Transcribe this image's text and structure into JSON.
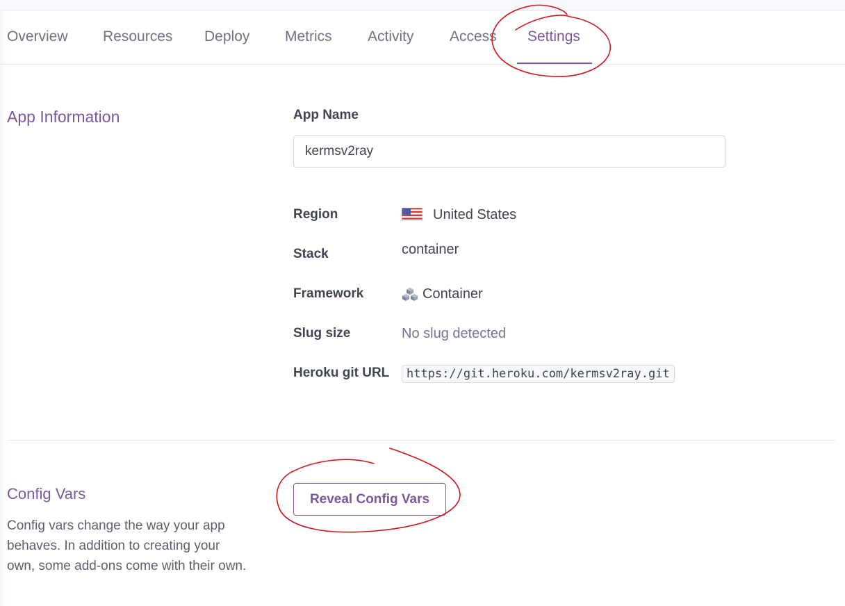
{
  "tabs": [
    {
      "label": "Overview"
    },
    {
      "label": "Resources"
    },
    {
      "label": "Deploy"
    },
    {
      "label": "Metrics"
    },
    {
      "label": "Activity"
    },
    {
      "label": "Access"
    },
    {
      "label": "Settings",
      "active": true
    }
  ],
  "app_info": {
    "section_title": "App Information",
    "app_name_label": "App Name",
    "app_name_value": "kermsv2ray",
    "rows": {
      "region": {
        "label": "Region",
        "value": "United States",
        "icon": "us-flag-icon"
      },
      "stack": {
        "label": "Stack",
        "value": "container"
      },
      "framework": {
        "label": "Framework",
        "value": "Container",
        "icon": "cubes-icon"
      },
      "slug_size": {
        "label": "Slug size",
        "value": "No slug detected"
      },
      "git_url": {
        "label": "Heroku git URL",
        "value": "https://git.heroku.com/kermsv2ray.git"
      }
    }
  },
  "config_vars": {
    "section_title": "Config Vars",
    "description": "Config vars change the way your app behaves. In addition to creating your own, some add-ons come with their own.",
    "reveal_button_label": "Reveal Config Vars"
  },
  "colors": {
    "accent": "#79589f",
    "annotation": "#d0141a",
    "text": "#3f4650"
  }
}
